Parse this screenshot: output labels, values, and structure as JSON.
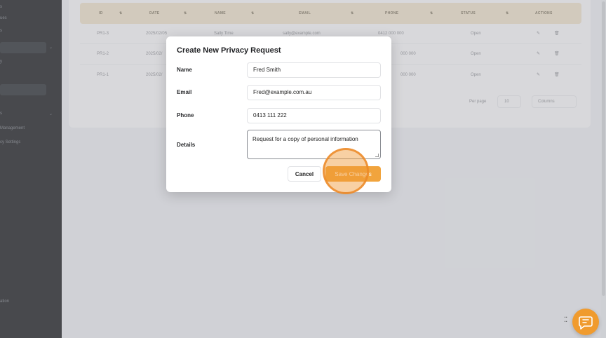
{
  "sidebar": {
    "items": [
      {
        "label": "s"
      },
      {
        "label": "ues"
      },
      {
        "label": "s"
      },
      {
        "label": ""
      },
      {
        "label": "y"
      },
      {
        "label": ""
      },
      {
        "label": "s"
      },
      {
        "label": "Management"
      },
      {
        "label": "cy Settings"
      },
      {
        "label": "ation"
      }
    ]
  },
  "table": {
    "headers": [
      "ID",
      "DATE",
      "NAME",
      "EMAIL",
      "PHONE",
      "STATUS",
      "ACTIONS"
    ],
    "rows": [
      {
        "id": "PR1-3",
        "date": "2025/02/05",
        "name": "Sally Time",
        "email": "sally@example.com",
        "phone": "0412 000 000",
        "status": "Open"
      },
      {
        "id": "PR1-2",
        "date": "2025/02/",
        "name": "",
        "email": "",
        "phone": "000 000",
        "status": "Open"
      },
      {
        "id": "PR1-1",
        "date": "2025/02/",
        "name": "",
        "email": "",
        "phone": "000 000",
        "status": "Open"
      }
    ],
    "per_page_label": "Per page",
    "per_page_value": "10",
    "columns_label": "Columns"
  },
  "modal": {
    "title": "Create New Privacy Request",
    "fields": {
      "name": {
        "label": "Name",
        "value": "Fred Smith"
      },
      "email": {
        "label": "Email",
        "value": "Fred@example.com.au"
      },
      "phone": {
        "label": "Phone",
        "value": "0413 111 222"
      },
      "details": {
        "label": "Details",
        "value": "Request for a copy of personal information"
      }
    },
    "cancel_label": "Cancel",
    "save_label": "Save Changes"
  },
  "colors": {
    "accent": "#f1a43d",
    "sidebar": "#3d3f43",
    "table_header": "#e6dccb"
  },
  "icons": {
    "chat": "chat-bubble-icon",
    "drag": "drag-handle-icon",
    "edit": "edit-icon",
    "delete": "trash-icon"
  }
}
